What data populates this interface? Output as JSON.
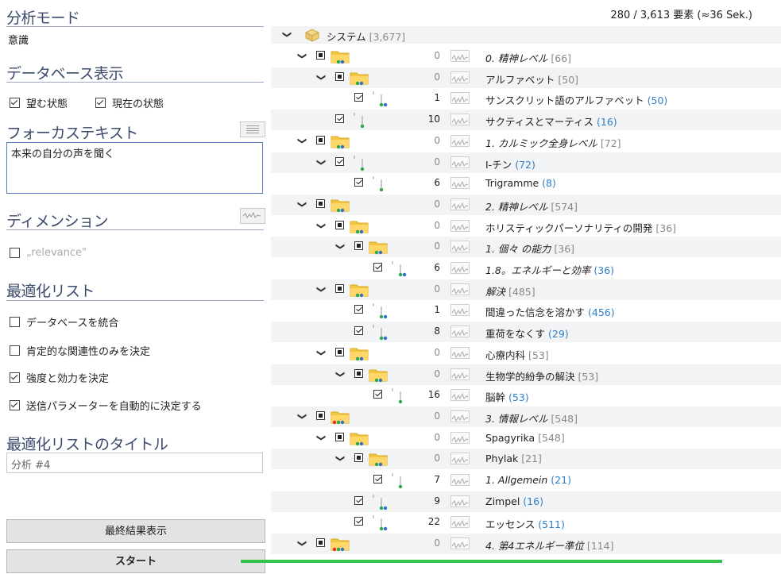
{
  "status": "280 / 3,613 要素 (≈36 Sek.)",
  "left": {
    "analysis_mode": {
      "title": "分析モード",
      "value": "意識"
    },
    "db_display": {
      "title": "データベース表示",
      "opt1": "望む状態",
      "opt2": "現在の状態"
    },
    "focus_text": {
      "title": "フォーカステキスト",
      "value": "本来の自分の声を聞く"
    },
    "dimension": {
      "title": "ディメンション",
      "relevance": "„relevance\""
    },
    "opt_list": {
      "title": "最適化リスト",
      "options": [
        "データベースを統合",
        "肯定的な関連性のみを決定",
        "強度と効力を決定",
        "送信パラメーターを自動的に決定する"
      ]
    },
    "opt_list_title": {
      "title": "最適化リストのタイトル",
      "value": "分析 #4"
    },
    "final_button": "最終結果表示",
    "start_button": "スタート"
  },
  "tree": {
    "root": {
      "label": "システム",
      "count": "[3,677]"
    },
    "rows": [
      {
        "num": "0",
        "label": "0. 精神レベル",
        "count": "[66]"
      },
      {
        "num": "0",
        "label": "アルファベット",
        "count": "[50]"
      },
      {
        "num": "1",
        "label": "サンスクリット語のアルファベット",
        "count": "(50)"
      },
      {
        "num": "10",
        "label": "サクティスとマーティス",
        "count": "(16)"
      },
      {
        "num": "0",
        "label": "1. カルミック全身レベル",
        "count": "[72]"
      },
      {
        "num": "0",
        "label": "I-チン",
        "count": "(72)"
      },
      {
        "num": "6",
        "label": "Trigramme",
        "count": "(8)"
      },
      {
        "num": "0",
        "label": "2. 精神レベル",
        "count": "[574]"
      },
      {
        "num": "0",
        "label": "ホリスティックパーソナリティの開発",
        "count": "[36]"
      },
      {
        "num": "0",
        "label": "1. 個々 の能力",
        "count": "[36]"
      },
      {
        "num": "6",
        "label": "1.8。エネルギーと効率",
        "count": "(36)"
      },
      {
        "num": "0",
        "label": "解決",
        "count": "[485]"
      },
      {
        "num": "1",
        "label": "間違った信念を溶かす",
        "count": "(456)"
      },
      {
        "num": "8",
        "label": "重荷をなくす",
        "count": "(29)"
      },
      {
        "num": "0",
        "label": "心療内科",
        "count": "[53]"
      },
      {
        "num": "0",
        "label": "生物学的紛争の解決",
        "count": "[53]"
      },
      {
        "num": "16",
        "label": "脳幹",
        "count": "(53)"
      },
      {
        "num": "0",
        "label": "3. 情報レベル",
        "count": "[548]"
      },
      {
        "num": "0",
        "label": "Spagyrika",
        "count": "[548]"
      },
      {
        "num": "0",
        "label": "Phylak",
        "count": "[21]"
      },
      {
        "num": "7",
        "label": "1. Allgemein",
        "count": "(21)"
      },
      {
        "num": "9",
        "label": "Zimpel",
        "count": "(16)"
      },
      {
        "num": "22",
        "label": "エッセンス",
        "count": "(511)"
      },
      {
        "num": "0",
        "label": "4. 第4エネルギー準位",
        "count": "[114]"
      }
    ]
  }
}
